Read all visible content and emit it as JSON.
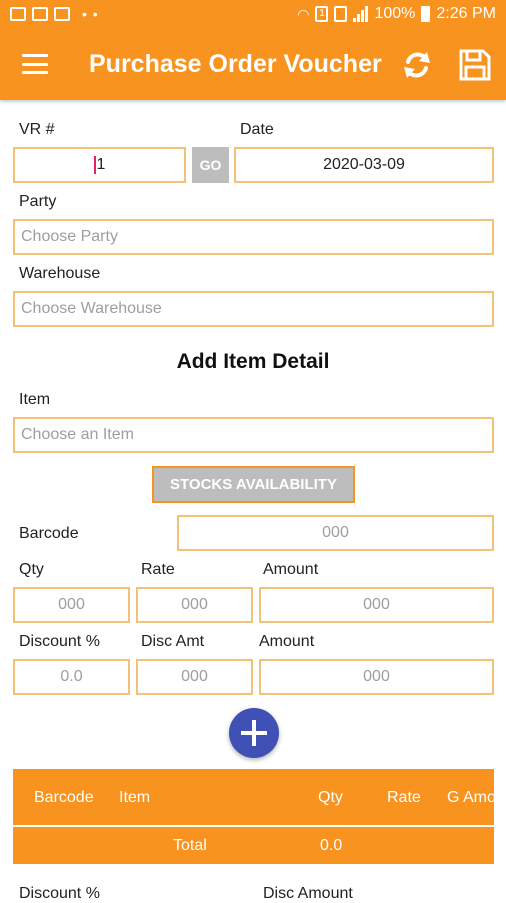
{
  "status_bar": {
    "battery": "100%",
    "time": "2:26 PM",
    "sim_badge": "1"
  },
  "app_bar": {
    "title": "Purchase Order Voucher",
    "icons": [
      "menu-icon",
      "refresh-icon",
      "save-icon"
    ]
  },
  "form": {
    "vr_label": "VR #",
    "vr_value": "1",
    "go_label": "GO",
    "date_label": "Date",
    "date_value": "2020-03-09",
    "party_label": "Party",
    "party_placeholder": "Choose Party",
    "warehouse_label": "Warehouse",
    "warehouse_placeholder": "Choose Warehouse"
  },
  "item_detail": {
    "title": "Add Item Detail",
    "item_label": "Item",
    "item_placeholder": "Choose an Item",
    "stocks_button": "STOCKS AVAILABILITY",
    "barcode_label": "Barcode",
    "barcode_placeholder": "000",
    "qty_label": "Qty",
    "qty_placeholder": "000",
    "rate_label": "Rate",
    "rate_placeholder": "000",
    "amount_label": "Amount",
    "amount_placeholder": "000",
    "discount_pct_label": "Discount %",
    "discount_pct_placeholder": "0.0",
    "disc_amt_label": "Disc Amt",
    "disc_amt_placeholder": "000",
    "amount2_label": "Amount",
    "amount2_placeholder": "000"
  },
  "table": {
    "columns": [
      "Barcode",
      "Item",
      "Qty",
      "Rate",
      "G Amo"
    ],
    "total_label": "Total",
    "total_qty": "0.0"
  },
  "footer_labels": {
    "discount_pct": "Discount %",
    "disc_amount": "Disc Amount"
  },
  "colors": {
    "primary": "#f7931e",
    "field_border": "#f3c27a",
    "fab": "#3f51b5",
    "button_gray": "#bdbdbd"
  }
}
